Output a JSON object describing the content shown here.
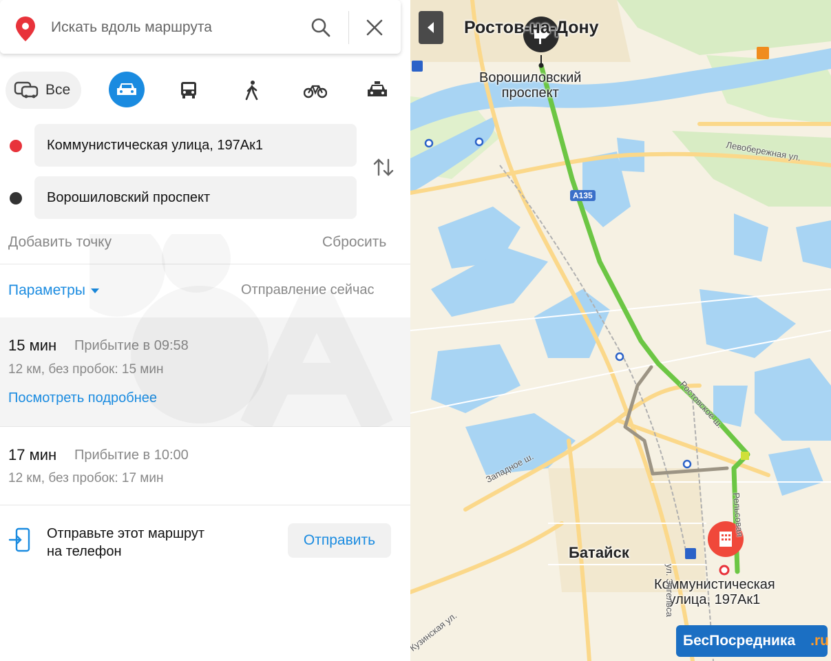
{
  "search": {
    "placeholder": "Искать вдоль маршрута",
    "icons": {
      "pin": "map-pin-icon",
      "search": "search-icon",
      "close": "close-icon"
    }
  },
  "modes": {
    "all_label": "Все",
    "items": [
      "all",
      "car",
      "bus",
      "walk",
      "bike",
      "taxi"
    ],
    "active": "car",
    "accent": "#1a8be0"
  },
  "points": {
    "from": {
      "label": "Коммунистическая улица, 197Ак1",
      "color": "#e8333b"
    },
    "to": {
      "label": "Ворошиловский проспект",
      "color": "#333333"
    }
  },
  "actions": {
    "add_point": "Добавить точку",
    "reset": "Сбросить"
  },
  "params": {
    "label": "Параметры",
    "departure": "Отправление сейчас"
  },
  "routes": [
    {
      "time": "15 мин",
      "arrival": "Прибытие в 09:58",
      "info": "12 км, без пробок: 15 мин",
      "details": "Посмотреть подробнее",
      "selected": true
    },
    {
      "time": "17 мин",
      "arrival": "Прибытие в 10:00",
      "info": "12 км, без пробок: 17 мин",
      "selected": false
    }
  ],
  "send": {
    "text_line1": "Отправьте этот маршрут",
    "text_line2": "на телефон",
    "button": "Отправить"
  },
  "map": {
    "city_top": "Ростов-на-Дону",
    "start_label_line1": "Ворошиловский",
    "start_label_line2": "проспект",
    "city_bottom": "Батайск",
    "end_label_line1": "Коммунистическая",
    "end_label_line2": "улица, 197Ак1",
    "streets": [
      "Левобережная ул.",
      "Западное ш.",
      "Ростовское ш.",
      "ул. Энгельса",
      "Кузинская ул.",
      "Рельсовая"
    ],
    "road_badge": "А135",
    "route_color": "#6cc644",
    "alt_route_color": "#9c9484"
  },
  "brand": {
    "name": "БесПосредника",
    "tld": ".ru"
  }
}
